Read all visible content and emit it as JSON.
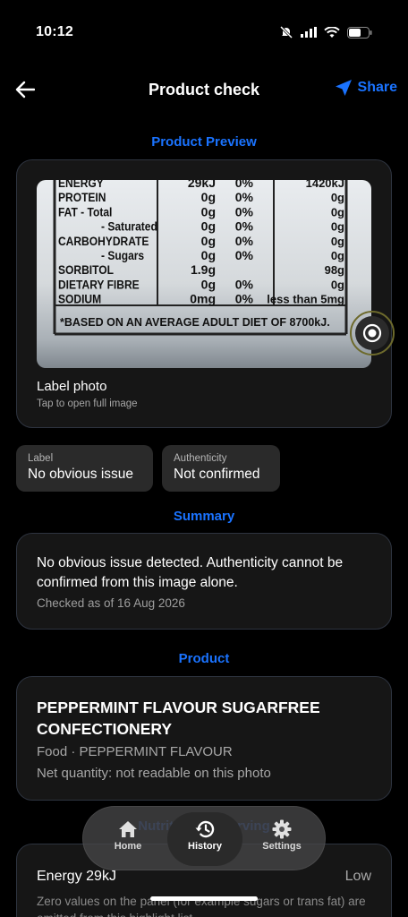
{
  "status": {
    "time": "10:12"
  },
  "nav": {
    "title": "Product check",
    "share_label": "Share"
  },
  "preview": {
    "heading": "Product Preview",
    "photo_label": "Label photo",
    "photo_hint": "Tap to open full image",
    "label_rows": [
      {
        "name": "ENERGY",
        "v1": "29kJ",
        "v2": "0%",
        "v3": "1420kJ"
      },
      {
        "name": "PROTEIN",
        "v1": "0g",
        "v2": "0%",
        "v3": "0g"
      },
      {
        "name": "FAT - Total",
        "v1": "0g",
        "v2": "0%",
        "v3": "0g"
      },
      {
        "name": "- Saturated",
        "v1": "0g",
        "v2": "0%",
        "v3": "0g"
      },
      {
        "name": "CARBOHYDRATE",
        "v1": "0g",
        "v2": "0%",
        "v3": "0g"
      },
      {
        "name": "- Sugars",
        "v1": "0g",
        "v2": "0%",
        "v3": "0g"
      },
      {
        "name": "SORBITOL",
        "v1": "1.9g",
        "v2": "",
        "v3": "98g"
      },
      {
        "name": "DIETARY FIBRE",
        "v1": "0g",
        "v2": "0%",
        "v3": "0g"
      },
      {
        "name": "SODIUM",
        "v1": "0mg",
        "v2": "0%",
        "v3": "less than 5mg"
      }
    ],
    "label_footnote": "*BASED ON AN AVERAGE ADULT DIET OF 8700kJ."
  },
  "chips": {
    "label": {
      "key": "Label",
      "value": "No obvious issue"
    },
    "authenticity": {
      "key": "Authenticity",
      "value": "Not confirmed"
    }
  },
  "summary": {
    "heading": "Summary",
    "text": "No obvious issue detected. Authenticity cannot be confirmed from this image alone.",
    "checked": "Checked as of 16 Aug 2026"
  },
  "product": {
    "heading": "Product",
    "name": "PEPPERMINT FLAVOUR SUGARFREE CONFECTIONERY",
    "category": "Food · PEPPERMINT FLAVOUR",
    "quantity": "Net quantity: not readable on this photo"
  },
  "nutrition": {
    "heading": "Nutrition per serving",
    "energy_label": "Energy  29kJ",
    "energy_level": "Low",
    "note": "Zero values on the panel (for example sugars or trans fat) are omitted from this highlight list."
  },
  "tabs": [
    {
      "label": "Home",
      "icon": "home-icon"
    },
    {
      "label": "History",
      "icon": "history-icon"
    },
    {
      "label": "Settings",
      "icon": "gear-icon"
    }
  ],
  "colors": {
    "accent": "#1a73ff",
    "card": "#161616",
    "chip": "#2a2a2a"
  }
}
